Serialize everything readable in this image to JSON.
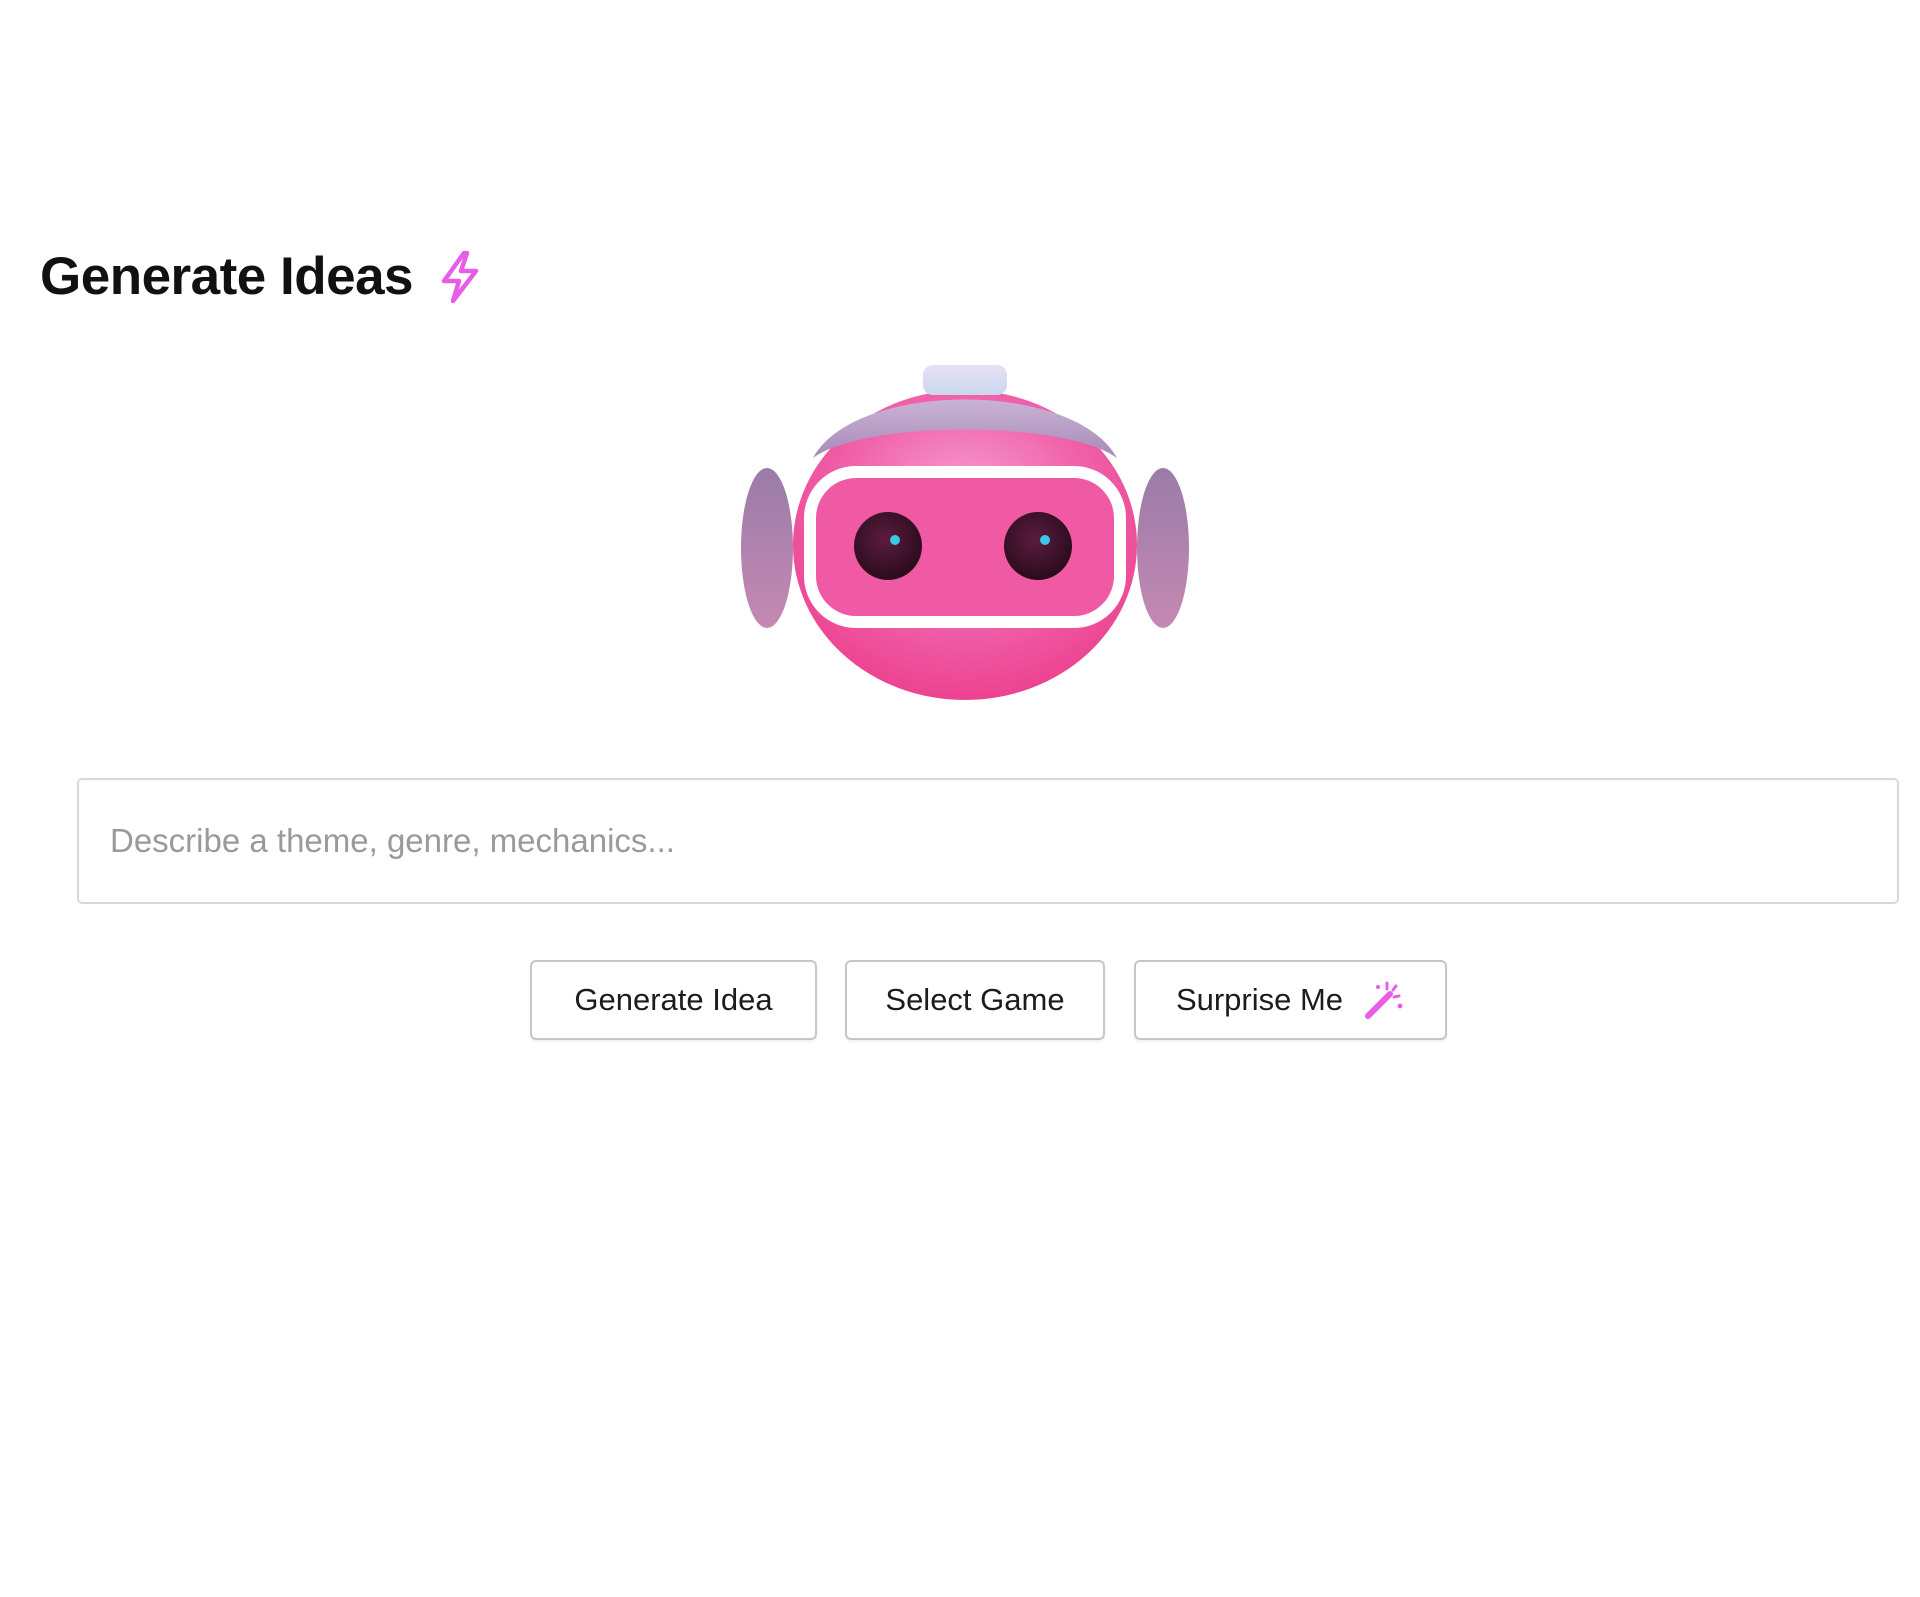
{
  "header": {
    "title": "Generate Ideas",
    "title_icon": "lightning-bolt-icon"
  },
  "mascot": {
    "icon": "robot-head-icon"
  },
  "prompt": {
    "placeholder": "Describe a theme, genre, mechanics...",
    "value": ""
  },
  "actions": {
    "generate_label": "Generate Idea",
    "select_label": "Select Game",
    "surprise_label": "Surprise Me",
    "surprise_icon": "magic-wand-icon"
  },
  "colors": {
    "accent": "#e85ce8",
    "robot_pink": "#ef4d97",
    "robot_helmet": "#b18fc0",
    "border": "#d8d8d8",
    "text": "#111111",
    "placeholder": "#9a9a9a"
  }
}
